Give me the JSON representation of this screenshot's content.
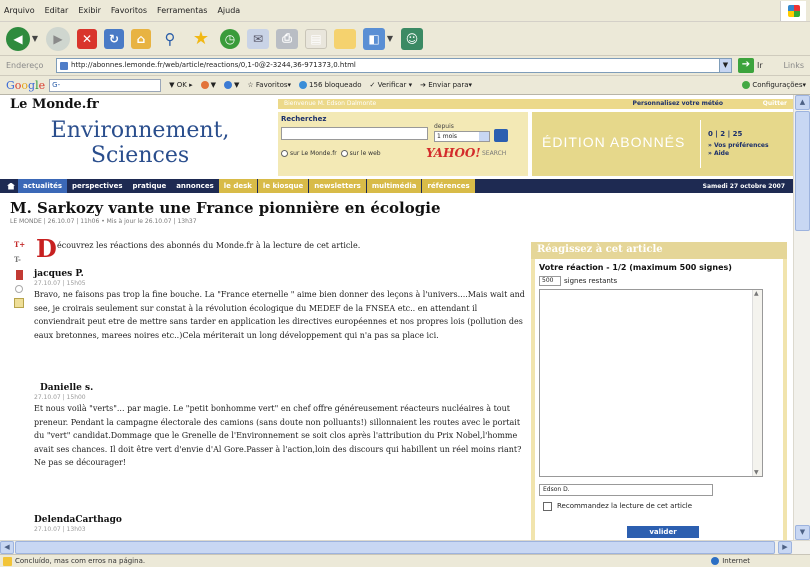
{
  "browser": {
    "menu": [
      "Arquivo",
      "Editar",
      "Exibir",
      "Favoritos",
      "Ferramentas",
      "Ajuda"
    ],
    "address_label": "Endereço",
    "url": "http://abonnes.lemonde.fr/web/article/reactions/0,1-0@2-3244,36-971373,0.html",
    "go_label": "Ir",
    "links_label": "Links",
    "google": {
      "search_placeholder": "G-",
      "ok_label": "OK",
      "favoritos_label": "Favoritos",
      "blocked_label": "156 bloqueado",
      "verificar_label": "Verificar",
      "enviar_label": "Enviar para",
      "config_label": "Configurações"
    },
    "status_text": "Concluído, mas com erros na página.",
    "zone_text": "Internet"
  },
  "site": {
    "logo": "Le Monde.fr",
    "greeting": "Bienvenue M. Edson Dalmonte",
    "personalize": "Personnalisez votre météo",
    "quit": "Quitter",
    "section_title_line1": "Environnement,",
    "section_title_line2": "Sciences",
    "search": {
      "label": "Recherchez",
      "depuis": "depuis",
      "period": "1 mois",
      "radio_lemonde": "sur Le Monde.fr",
      "radio_web": "sur le web",
      "yahoo": "YAHOO!",
      "yahoo_search": "SEARCH"
    },
    "abonnes": {
      "title": "ÉDITION ABONNÉS",
      "counters": "0 | 2 | 25",
      "link1": "» Vos préférences",
      "link2": "» Aide"
    },
    "nav": [
      "actualités",
      "perspectives",
      "pratique",
      "annonces",
      "le desk",
      "le kiosque",
      "newsletters",
      "multimédia",
      "références"
    ],
    "date": "Samedi 27 octobre 2007"
  },
  "article": {
    "title": "M. Sarkozy vante une France pionnière en écologie",
    "meta": "LE MONDE | 26.10.07 | 11h06 • Mis à jour le 26.10.07 | 13h37",
    "intro_dropcap": "D",
    "intro_text": "écouvrez les réactions des abonnés du Monde.fr à la lecture de cet article.",
    "comments": [
      {
        "author": "jacques P.",
        "date": "27.10.07 | 15h05",
        "body": "Bravo, ne faisons pas trop la fine bouche. La \"France eternelle \" aime bien donner des leçons à l'univers....Mais wait and see, je croirais seulement sur constat à la révolution écologique du MEDEF de la FNSEA etc.. en attendant il conviendrait peut etre de mettre sans tarder en application les directives européennes et nos propres lois (pollution des eaux bretonnes, marees noires etc..)Cela mériterait un long développement qui n'a pas sa place ici."
      },
      {
        "author": "Danielle s.",
        "date": "27.10.07 | 15h00",
        "body": "Et nous voilà \"verts\"... par magie. Le \"petit bonhomme vert\" en chef offre généreusement réacteurs nucléaires à tout preneur. Pendant la campagne électorale des camions (sans doute non polluants!) sillonnaient les routes avec le portait du \"vert\" candidat.Dommage que le Grenelle de l'Environnement se soit clos après l'attribution du Prix Nobel,l'homme avait ses chances. Il doit être vert d'envie d'Al Gore.Passer à l'action,loin des discours qui habillent un réel moins riant? Ne pas se décourager!"
      },
      {
        "author": "DelendaCarthago",
        "date": "27.10.07 | 13h03",
        "body": ""
      }
    ]
  },
  "reaction_panel": {
    "header": "Réagissez à cet article",
    "title": "Votre réaction - 1/2 (maximum 500 signes)",
    "remaining_count": "500",
    "remaining_label": "signes restants",
    "name_value": "Edson D.",
    "recommend_label": "Recommandez la lecture de cet article",
    "submit_label": "valider"
  }
}
